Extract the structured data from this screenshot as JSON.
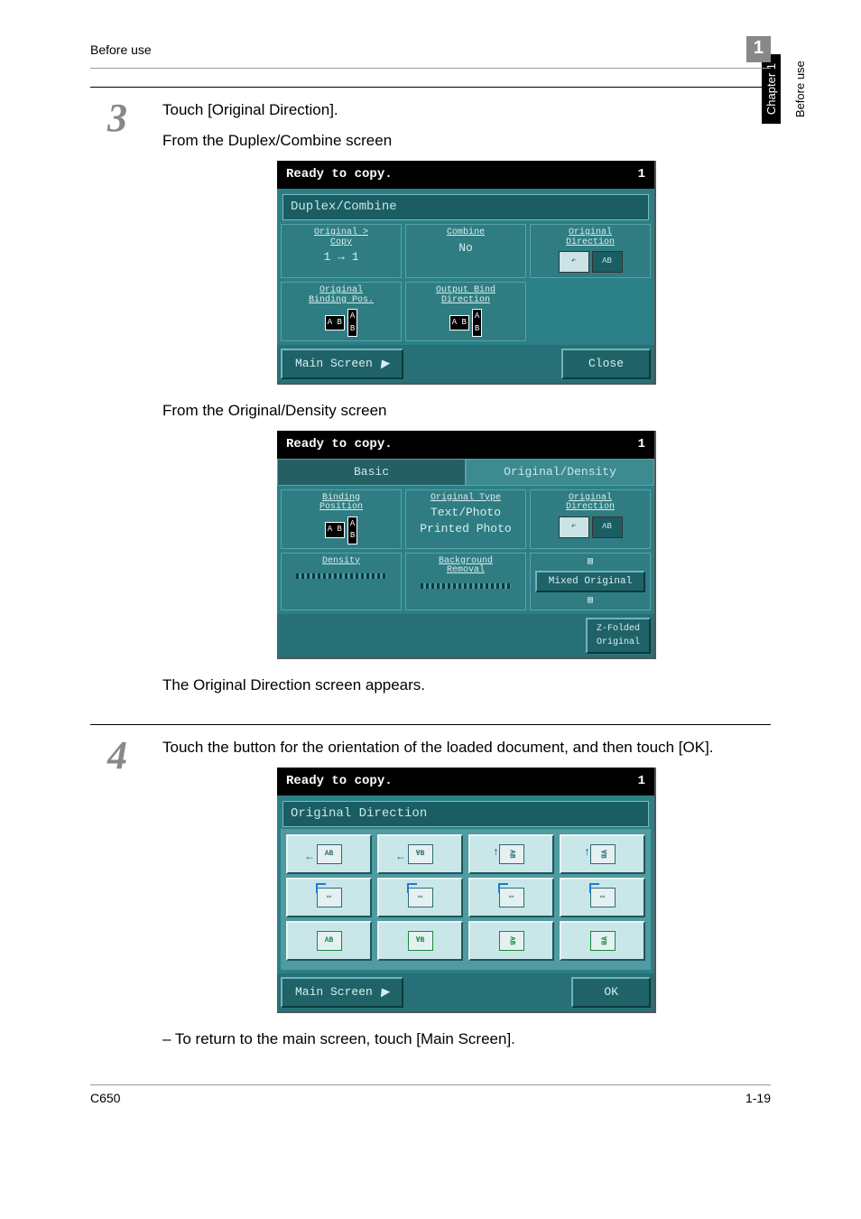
{
  "header": {
    "left": "Before use",
    "right": "1"
  },
  "side": {
    "chapter": "Chapter 1",
    "section": "Before use"
  },
  "step3": {
    "num": "3",
    "line1": "Touch [Original Direction].",
    "line2": "From the Duplex/Combine screen"
  },
  "screen1": {
    "status": "Ready to copy.",
    "count": "1",
    "title": "Duplex/Combine",
    "cells": {
      "orig_copy_lbl": "Original >\nCopy",
      "orig_copy_val": "1  →  1",
      "combine_lbl": "Combine",
      "combine_val": "No",
      "orig_dir_lbl": "Original\nDirection",
      "bind_pos_lbl": "Original\nBinding Pos.",
      "out_bind_lbl": "Output Bind\nDirection"
    },
    "main_btn": "Main Screen",
    "close_btn": "Close"
  },
  "mid_text": "From the Original/Density screen",
  "screen2": {
    "status": "Ready to copy.",
    "count": "1",
    "tab_basic": "Basic",
    "tab_od": "Original/Density",
    "cells": {
      "bind_pos_lbl": "Binding\nPosition",
      "otype_lbl": "Original Type",
      "otype_val1": "Text/Photo",
      "otype_val2": "Printed Photo",
      "odir_lbl": "Original\nDirection",
      "density_lbl": "Density",
      "bg_lbl": "Background\nRemoval",
      "mixed_lbl": "Mixed Original",
      "zfold_lbl": "Z-Folded\nOriginal"
    }
  },
  "after_screen2": "The Original Direction screen appears.",
  "step4": {
    "num": "4",
    "line1": "Touch the button for the orientation of the loaded document, and then touch [OK]."
  },
  "screen3": {
    "status": "Ready to copy.",
    "count": "1",
    "title": "Original Direction",
    "main_btn": "Main Screen",
    "ok_btn": "OK"
  },
  "note": "–  To return to the main screen, touch [Main Screen].",
  "footer": {
    "left": "C650",
    "right": "1-19"
  }
}
